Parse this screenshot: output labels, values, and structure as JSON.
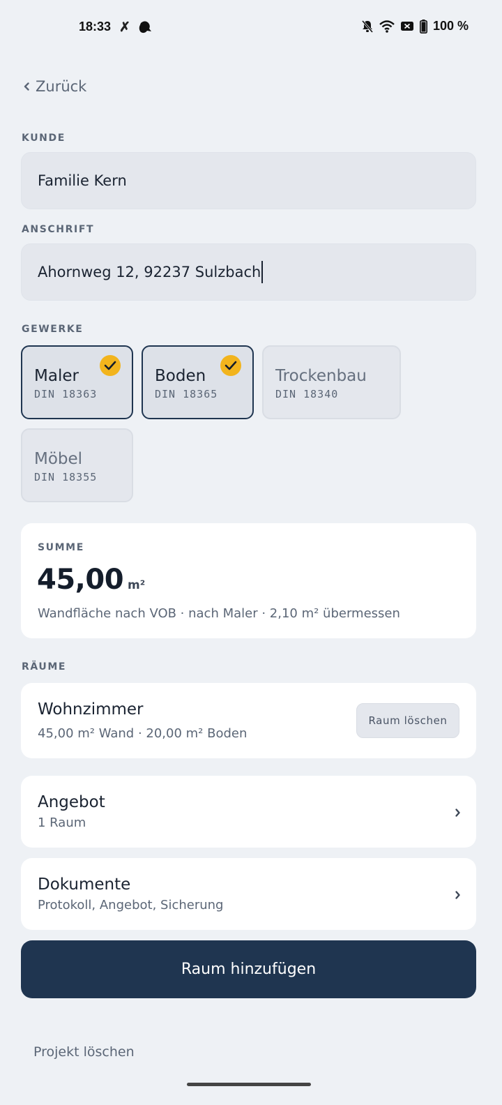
{
  "status_bar": {
    "time": "18:33",
    "battery": "100 %",
    "icons": [
      "x-notification-icon",
      "bird-notification-icon",
      "bell-off-icon",
      "wifi-icon",
      "sim-blocked-icon",
      "battery-icon"
    ]
  },
  "nav": {
    "back_label": "Zurück"
  },
  "customer": {
    "label": "KUNDE",
    "value": "Familie Kern"
  },
  "address": {
    "label": "ANSCHRIFT",
    "value": "Ahornweg 12, 92237 Sulzbach"
  },
  "trades": {
    "label": "GEWERKE",
    "items": [
      {
        "name": "Maler",
        "din": "DIN 18363",
        "selected": true
      },
      {
        "name": "Boden",
        "din": "DIN 18365",
        "selected": true
      },
      {
        "name": "Trockenbau",
        "din": "DIN 18340",
        "selected": false
      },
      {
        "name": "Möbel",
        "din": "DIN 18355",
        "selected": false
      }
    ]
  },
  "summary": {
    "label": "SUMME",
    "value": "45,00",
    "unit": "m²",
    "detail": "Wandfläche nach VOB · nach Maler · 2,10 m² übermessen"
  },
  "rooms": {
    "label": "RÄUME",
    "items": [
      {
        "name": "Wohnzimmer",
        "detail": "45,00 m² Wand · 20,00 m² Boden",
        "delete_label": "Raum löschen"
      }
    ]
  },
  "offer": {
    "title": "Angebot",
    "subtitle": "1 Raum"
  },
  "documents": {
    "title": "Dokumente",
    "subtitle": "Protokoll, Angebot, Sicherung"
  },
  "actions": {
    "add_room": "Raum hinzufügen",
    "delete_project": "Projekt löschen"
  },
  "colors": {
    "accent": "#1f3550",
    "check": "#f2b41d",
    "background": "#eef1f5"
  }
}
